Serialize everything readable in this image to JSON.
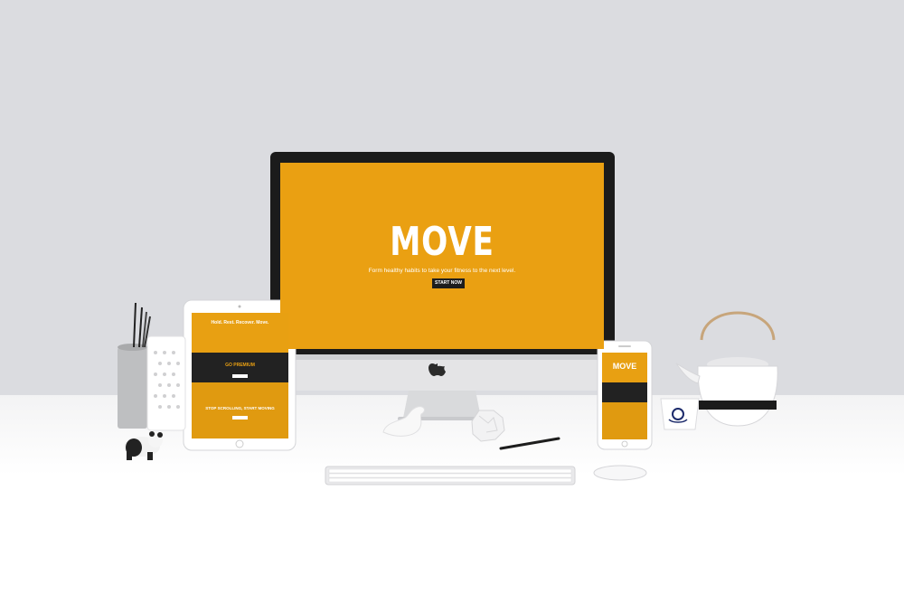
{
  "imac": {
    "title": "MOVE",
    "tagline": "Form healthy habits to take your fitness to the next level.",
    "button": "START NOW"
  },
  "ipad": {
    "hero_heading": "Hold. Rest. Recover. Move.",
    "section_heading": "GO PREMIUM",
    "photo_heading": "STOP SCROLLING, START MOVING"
  },
  "iphone": {
    "title": "MOVE"
  },
  "colors": {
    "wall": "#dbdce0",
    "desk": "#f5f5f6",
    "accent": "#eaa012",
    "dark": "#1d1d1d"
  }
}
